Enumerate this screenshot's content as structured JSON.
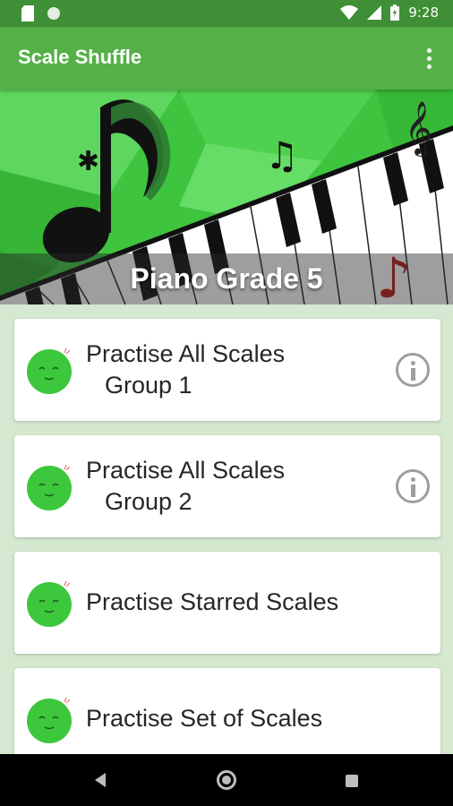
{
  "status_bar": {
    "time": "9:28",
    "icons": [
      "sd-card-icon",
      "circle-notification-icon",
      "wifi-icon",
      "signal-icon",
      "battery-icon"
    ]
  },
  "app_bar": {
    "title": "Scale Shuffle",
    "menu_icon": "overflow-menu-icon"
  },
  "banner": {
    "title": "Piano Grade 5"
  },
  "list": {
    "items": [
      {
        "line1": "Practise All Scales",
        "line2": "Group 1",
        "icon": "smiley-face-icon",
        "has_info": true
      },
      {
        "line1": "Practise All Scales",
        "line2": "Group 2",
        "icon": "smiley-face-icon",
        "has_info": true
      },
      {
        "line1": "Practise Starred Scales",
        "line2": "",
        "icon": "smiley-face-icon",
        "has_info": false
      },
      {
        "line1": "Practise Set of Scales",
        "line2": "",
        "icon": "smiley-face-icon",
        "has_info": false
      }
    ]
  },
  "nav_bar": {
    "icons": [
      "back-icon",
      "home-icon",
      "recent-apps-icon"
    ]
  },
  "colors": {
    "status_bar": "#3f8f36",
    "app_bar": "#54b047",
    "background": "#d4e9cf",
    "face_green": "#3cc73c"
  }
}
